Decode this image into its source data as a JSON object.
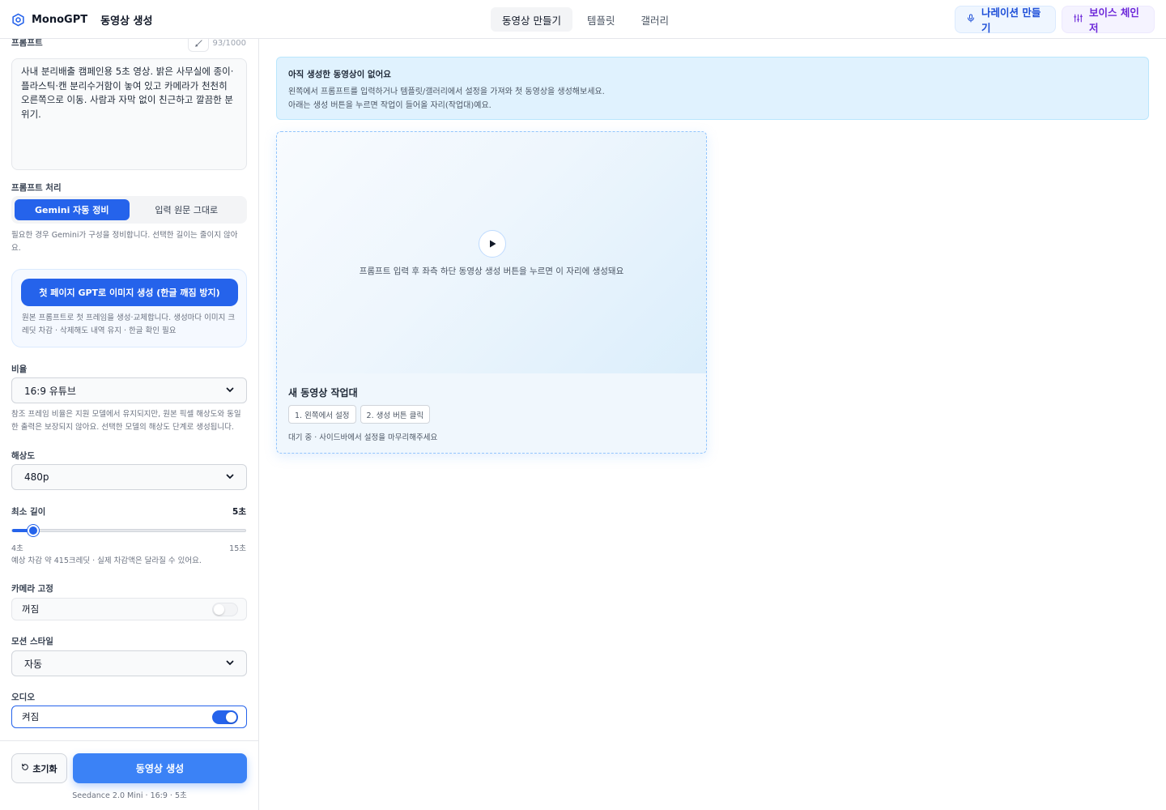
{
  "header": {
    "brand_name": "MonoGPT",
    "brand_sub": "동영상 생성",
    "tabs": [
      {
        "label": "동영상 만들기",
        "active": true
      },
      {
        "label": "템플릿",
        "active": false
      },
      {
        "label": "갤러리",
        "active": false
      }
    ],
    "narration_button": "나레이션 만들기",
    "voice_changer_button": "보이스 체인저"
  },
  "sidebar": {
    "prompt": {
      "label": "프롬프트",
      "counter": "93/1000",
      "value": "사내 분리배출 캠페인용 5초 영상. 밝은 사무실에 종이·플라스틱·캔 분리수거함이 놓여 있고 카메라가 천천히 오른쪽으로 이동. 사람과 자막 없이 친근하고 깔끔한 분위기."
    },
    "prompt_processing": {
      "label": "프롬프트 처리",
      "options": [
        "Gemini 자동 정비",
        "입력 원문 그대로"
      ],
      "selected_index": 0,
      "help": "필요한 경우 Gemini가 구성을 정비합니다. 선택한 길이는 줄이지 않아요."
    },
    "gpt_first_frame": {
      "button": "첫 페이지 GPT로 이미지 생성 (한글 깨짐 방지)",
      "help": "원본 프롬프트로 첫 프레임을 생성·교체합니다. 생성마다 이미지 크레딧 차감 · 삭제해도 내역 유지 · 한글 확인 필요"
    },
    "ratio": {
      "label": "비율",
      "value": "16:9 유튜브",
      "help": "참조 프레임 비율은 지원 모델에서 유지되지만, 원본 픽셀 해상도와 동일한 출력은 보장되지 않아요. 선택한 모델의 해상도 단계로 생성됩니다."
    },
    "resolution": {
      "label": "해상도",
      "value": "480p"
    },
    "min_length": {
      "label": "최소 길이",
      "value_label": "5초",
      "min_label": "4초",
      "max_label": "15초",
      "min": 4,
      "max": 15,
      "value": 5,
      "help": "예상 차감 약 415크레딧 · 실제 차감액은 달라질 수 있어요."
    },
    "camera_fixed": {
      "label": "카메라 고정",
      "state_label": "꺼짐",
      "on": false
    },
    "motion_style": {
      "label": "모션 스타일",
      "value": "자동"
    },
    "audio": {
      "label": "오디오",
      "state_label": "켜짐",
      "on": true
    },
    "footer": {
      "reset_button": "초기화",
      "generate_button": "동영상 생성",
      "model_caption": "Seedance 2.0 Mini · 16:9 · 5초"
    }
  },
  "main": {
    "notice": {
      "title": "아직 생성한 동영상이 없어요",
      "line1": "왼쪽에서 프롬프트를 입력하거나 템플릿/갤러리에서 설정을 가져와 첫 동영상을 생성해보세요.",
      "line2": "아래는 생성 버튼을 누르면 작업이 들어올 자리(작업대)예요."
    },
    "card": {
      "preview_text": "프롬프트 입력 후 좌측 하단 동영상 생성 버튼을 누르면 이 자리에 생성돼요",
      "title": "새 동영상 작업대",
      "chips": [
        "1. 왼쪽에서 설정",
        "2. 생성 버튼 클릭"
      ],
      "status": "대기 중 · 사이드바에서 설정을 마무리해주세요"
    }
  },
  "colors": {
    "accent": "#2563eb",
    "narration": "#1d4ed8",
    "voice": "#6d28d9",
    "notice_bg": "#e0f2fe"
  },
  "icons": [
    "logo-icon",
    "microphone-icon",
    "sliders-icon",
    "pencil-icon",
    "chevron-down-icon",
    "reset-icon",
    "play-icon"
  ]
}
